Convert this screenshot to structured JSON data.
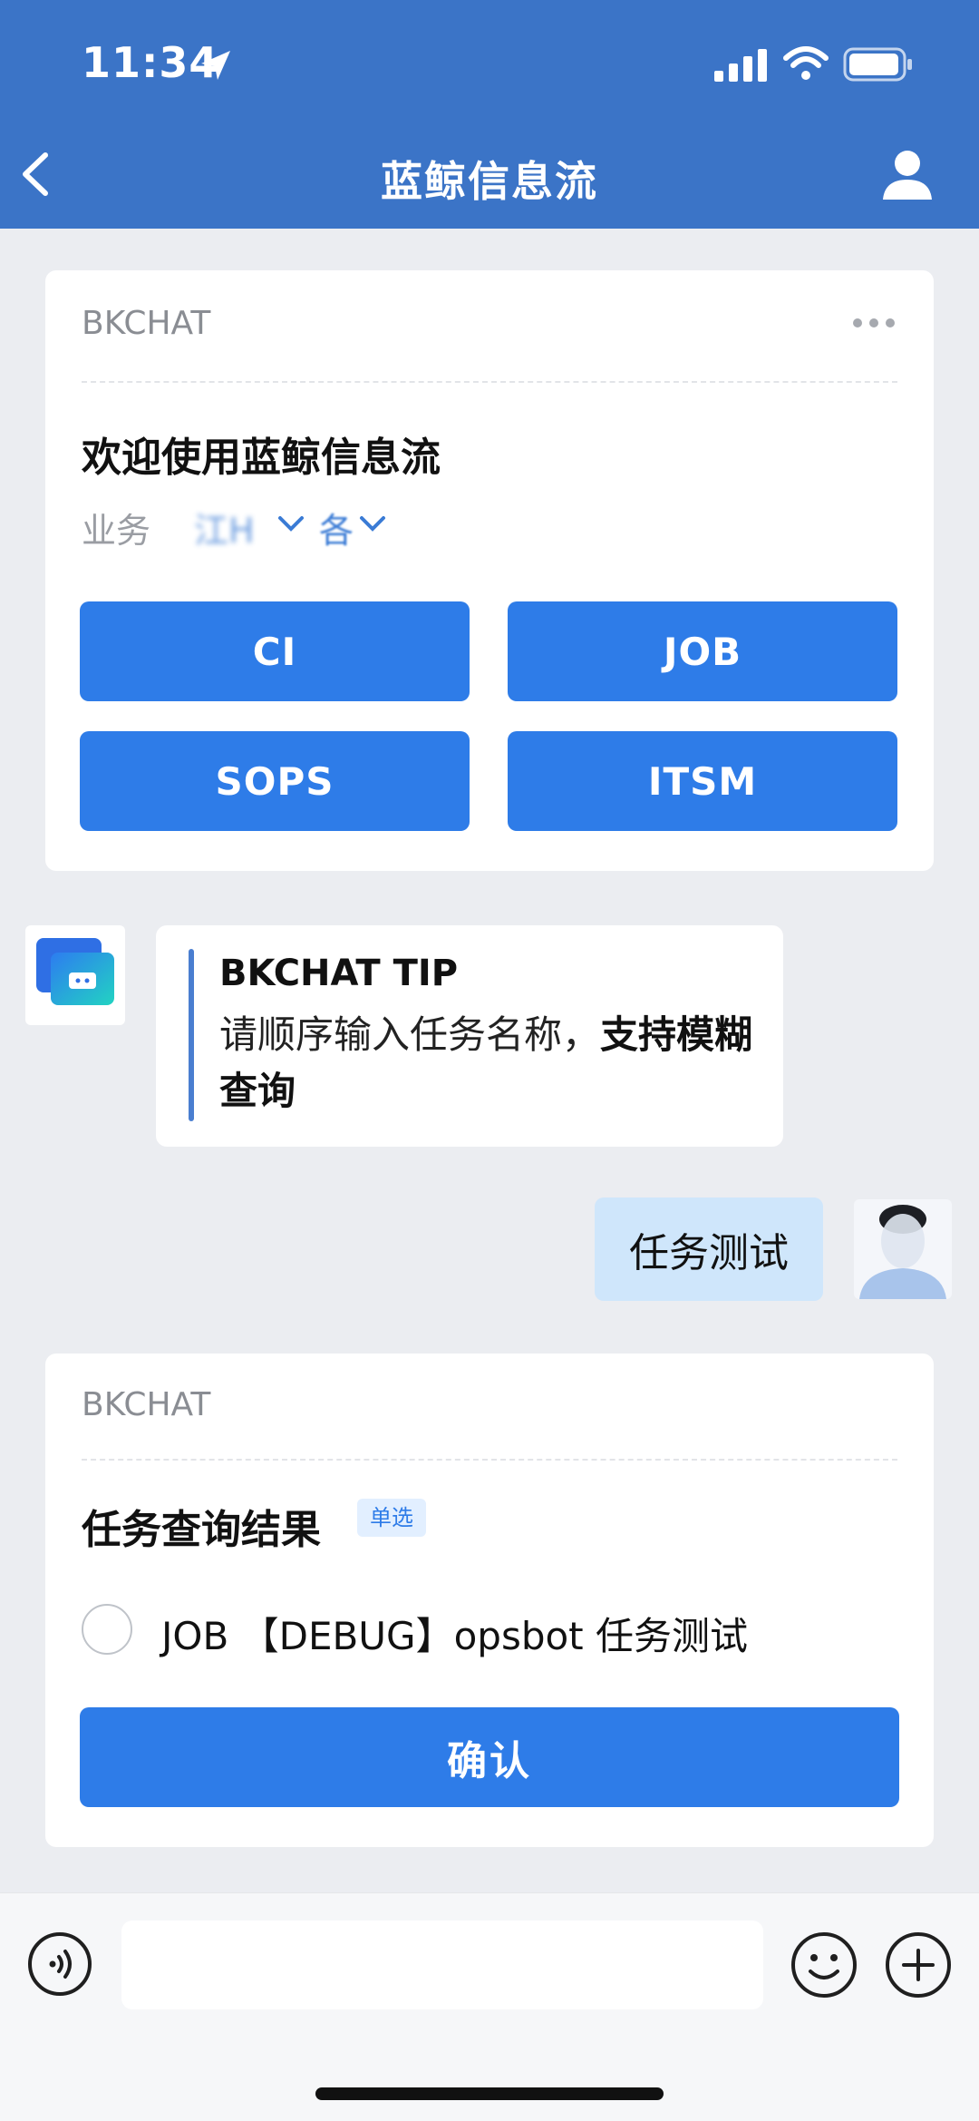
{
  "status_bar": {
    "time": "11:34"
  },
  "nav": {
    "title": "蓝鲸信息流"
  },
  "welcome_card": {
    "source": "BKCHAT",
    "title": "欢迎使用蓝鲸信息流",
    "business_label": "业务",
    "business_value": "江H",
    "business_value2": "各",
    "buttons": [
      "CI",
      "JOB",
      "SOPS",
      "ITSM"
    ]
  },
  "tip_message": {
    "title": "BKCHAT TIP",
    "body_prefix": "请顺序输入任务名称，",
    "body_bold": "支持模糊查询"
  },
  "user_message": {
    "text": "任务测试"
  },
  "result_card": {
    "source": "BKCHAT",
    "title": "任务查询结果",
    "tag": "单选",
    "options": [
      "JOB 【DEBUG】opsbot 任务测试"
    ],
    "confirm_label": "确认"
  },
  "composer": {
    "placeholder": ""
  },
  "colors": {
    "header": "#3b74c7",
    "primary": "#2e7ce8",
    "user_bubble": "#cfe6fb"
  },
  "icons": [
    "location-arrow-icon",
    "signal-icon",
    "wifi-icon",
    "battery-icon",
    "back-icon",
    "user-icon",
    "more-icon",
    "chevron-down-icon",
    "bot-avatar-icon",
    "voice-icon",
    "emoji-icon",
    "plus-icon"
  ]
}
